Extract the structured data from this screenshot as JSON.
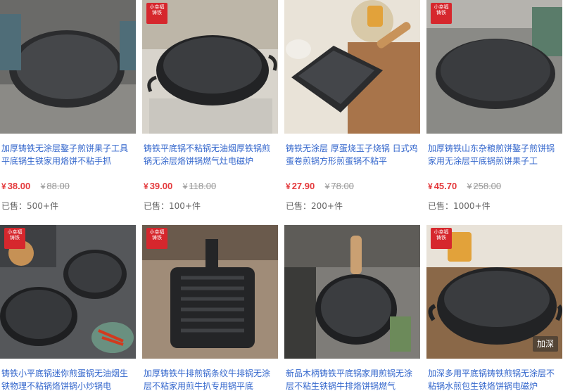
{
  "currency_symbol": "¥",
  "colors": {
    "title": "#3366cc",
    "price": "#e4393c",
    "original_price": "#999999",
    "sold": "#666666",
    "brand_badge": "#d6272d"
  },
  "products": [
    {
      "title": "加厚铸铁无涂层鏊子煎饼果子工具平底锅生铁家用烙饼不粘手抓",
      "price": "38.00",
      "original_price": "88.00",
      "sold_label": "已售：",
      "sold_count": "500+件",
      "image_icon": "round-griddle-pan"
    },
    {
      "title": "铸铁平底锅不粘锅无油烟厚铁锅煎锅无涂层烙饼锅燃气灶电磁炉",
      "price": "39.00",
      "original_price": "118.00",
      "sold_label": "已售：",
      "sold_count": "100+件",
      "image_icon": "deep-frying-pan"
    },
    {
      "title": "铸铁无涂层 厚蛋烧玉子烧锅 日式鸡蛋卷煎锅方形煎蛋锅不粘平",
      "price": "27.90",
      "original_price": "78.00",
      "sold_label": "已售：",
      "sold_count": "200+件",
      "image_icon": "square-tamagoyaki-pan"
    },
    {
      "title": "加厚铸铁山东杂粮煎饼鏊子煎饼锅家用无涂层平底锅煎饼果子工",
      "price": "45.70",
      "original_price": "258.00",
      "sold_label": "已售：",
      "sold_count": "1000+件",
      "image_icon": "crepe-griddle"
    },
    {
      "title": "铸铁小平底锅迷你煎蛋锅无油烟生铁物理不粘锅烙饼锅小炒锅电",
      "image_icon": "mini-skillet"
    },
    {
      "title": "加厚铸铁牛排煎锅条纹牛排锅无涂层不粘家用煎牛扒专用锅平底",
      "image_icon": "grill-pan"
    },
    {
      "title": "新品木柄铸铁平底锅家用煎锅无涂层不粘生铁锅牛排烙饼锅燃气",
      "image_icon": "wood-handle-skillet"
    },
    {
      "title": "加深多用平底锅铸铁煎锅无涂层不粘锅水煎包生铁烙饼锅电磁炉",
      "image_icon": "deep-dual-handle-pan",
      "tag": "加深"
    }
  ],
  "brand_badge": {
    "line1": "小幸福",
    "line2": "铸铁"
  }
}
